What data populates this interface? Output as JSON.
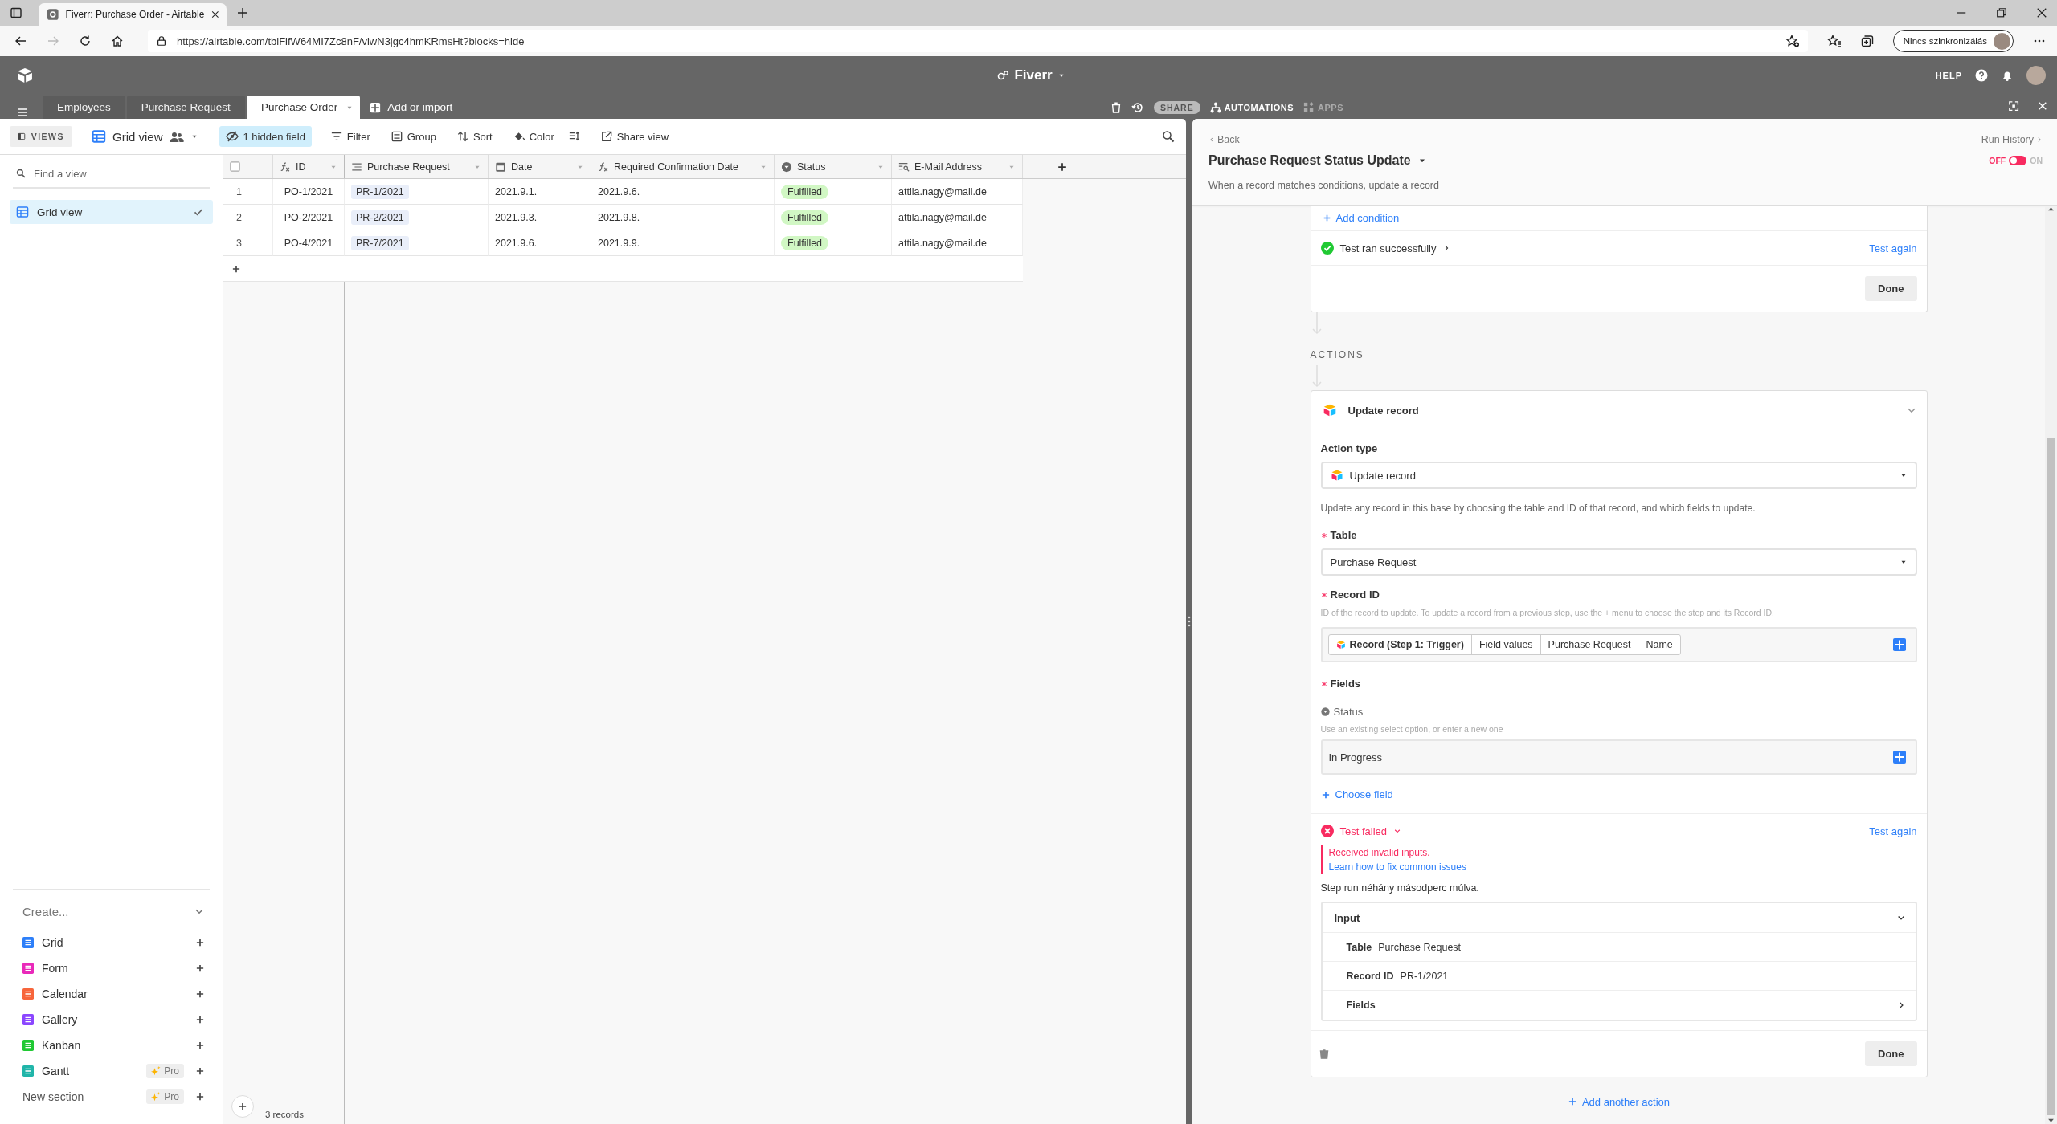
{
  "browser": {
    "tab_title": "Fiverr: Purchase Order - Airtable",
    "url": "https://airtable.com/tblFifW64MI7Zc8nF/viwN3jgc4hmKRmsHt?blocks=hide",
    "profile": "Nincs szinkronizálás"
  },
  "app": {
    "base_name": "Fiverr",
    "help": "HELP",
    "tables": [
      {
        "label": "Employees",
        "selected": false
      },
      {
        "label": "Purchase Request",
        "selected": false
      },
      {
        "label": "Purchase Order",
        "selected": true
      }
    ],
    "add_table": "Add or import",
    "share": "SHARE",
    "automations": "AUTOMATIONS",
    "apps": "APPS"
  },
  "toolbar": {
    "views": "VIEWS",
    "view_name": "Grid view",
    "hidden_fields": "1 hidden field",
    "filter": "Filter",
    "group": "Group",
    "sort": "Sort",
    "color_label": "Color",
    "share_view": "Share view"
  },
  "sidebar": {
    "search_placeholder": "Find a view",
    "views": [
      {
        "label": "Grid view",
        "selected": true
      }
    ],
    "create": "Create...",
    "create_items": [
      {
        "label": "Grid",
        "color": "#2d7ff9"
      },
      {
        "label": "Form",
        "color": "#e929ba"
      },
      {
        "label": "Calendar",
        "color": "#f7653b"
      },
      {
        "label": "Gallery",
        "color": "#8b46ff"
      },
      {
        "label": "Kanban",
        "color": "#20c933"
      },
      {
        "label": "Gantt",
        "color": "#20b5a9",
        "badge": "Pro"
      }
    ],
    "new_section": {
      "label": "New section",
      "badge": "Pro"
    }
  },
  "grid": {
    "all_selected": false,
    "columns": [
      {
        "label": "ID",
        "kind": "formula"
      },
      {
        "label": "Purchase Request",
        "kind": "link"
      },
      {
        "label": "Date",
        "kind": "date"
      },
      {
        "label": "Required Confirmation Date",
        "kind": "formula"
      },
      {
        "label": "Status",
        "kind": "select"
      },
      {
        "label": "E-Mail Address",
        "kind": "lookup"
      }
    ],
    "rows": [
      {
        "number": "1",
        "cells": [
          "PO-1/2021",
          "PR-1/2021",
          "2021.9.1.",
          "2021.9.6.",
          "Fulfilled",
          "attila.nagy@mail.de"
        ]
      },
      {
        "number": "2",
        "cells": [
          "PO-2/2021",
          "PR-2/2021",
          "2021.9.3.",
          "2021.9.8.",
          "Fulfilled",
          "attila.nagy@mail.de"
        ]
      },
      {
        "number": "3",
        "cells": [
          "PO-4/2021",
          "PR-7/2021",
          "2021.9.6.",
          "2021.9.9.",
          "Fulfilled",
          "attila.nagy@mail.de"
        ]
      }
    ],
    "footer": "3 records"
  },
  "automation": {
    "back": "Back",
    "run_history": "Run History",
    "title": "Purchase Request Status Update",
    "enabled": false,
    "off_label": "OFF",
    "on_label": "ON",
    "description": "When a record matches conditions, update a record",
    "trigger": {
      "add_condition": "Add condition",
      "test": {
        "kind": "success",
        "label": "Test ran successfully",
        "retry": "Test again"
      },
      "done": "Done"
    },
    "actions_heading": "ACTIONS",
    "action": {
      "title": "Update record",
      "action_type": {
        "label": "Action type",
        "value": "Update record"
      },
      "help": "Update any record in this base by choosing the table and ID of that record, and which fields to update.",
      "table": {
        "label": "Table",
        "required": true,
        "value": "Purchase Request"
      },
      "record_id": {
        "label": "Record ID",
        "required": true,
        "hint": "ID of the record to update. To update a record from a previous step, use the + menu to choose the step and its Record ID.",
        "tokens": [
          {
            "label": "Record (Step 1: Trigger)",
            "kind": "step"
          },
          {
            "label": "Field values",
            "kind": "path"
          },
          {
            "label": "Purchase Request",
            "kind": "path"
          },
          {
            "label": "Name",
            "kind": "path"
          }
        ]
      },
      "fields": {
        "label": "Fields",
        "required": true,
        "field": {
          "name": "Status",
          "hint": "Use an existing select option, or enter a new one",
          "value": "In Progress"
        },
        "choose": "Choose field"
      },
      "test": {
        "kind": "failed",
        "label": "Test failed",
        "retry": "Test again",
        "error": "Received invalid inputs.",
        "link": "Learn how to fix common issues",
        "time": "Step run néhány másodperc múlva.",
        "input": {
          "label": "Input",
          "rows": [
            {
              "label": "Table",
              "value": "Purchase Request"
            },
            {
              "label": "Record ID",
              "value": "PR-1/2021"
            },
            {
              "label": "Fields"
            }
          ]
        }
      },
      "done": "Done"
    },
    "add_action": "Add another action"
  }
}
